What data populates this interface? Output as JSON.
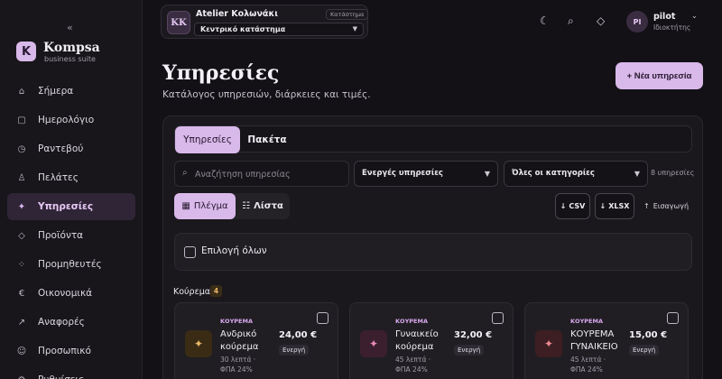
{
  "sidebar": {
    "collapse_icon": "«",
    "brand": {
      "logo_letter": "K",
      "name": "Kompsa",
      "subtitle": "business suite"
    },
    "items": [
      {
        "label": "Σήμερα",
        "icon": "home-icon",
        "glyph": "⌂",
        "active": false
      },
      {
        "label": "Ημερολόγιο",
        "icon": "calendar-icon",
        "glyph": "▢",
        "active": false
      },
      {
        "label": "Ραντεβού",
        "icon": "clock-icon",
        "glyph": "◷",
        "active": false
      },
      {
        "label": "Πελάτες",
        "icon": "user-icon",
        "glyph": "♙",
        "active": false
      },
      {
        "label": "Υπηρεσίες",
        "icon": "sparkle-icon",
        "glyph": "✦",
        "active": true
      },
      {
        "label": "Προϊόντα",
        "icon": "diamond-icon",
        "glyph": "◇",
        "active": false
      },
      {
        "label": "Προμηθευτές",
        "icon": "dots-icon",
        "glyph": "⁘",
        "active": false
      },
      {
        "label": "Οικονομικά",
        "icon": "euro-icon",
        "glyph": "€",
        "active": false
      },
      {
        "label": "Αναφορές",
        "icon": "trend-icon",
        "glyph": "↗",
        "active": false
      },
      {
        "label": "Προσωπικό",
        "icon": "staff-icon",
        "glyph": "☺",
        "active": false
      },
      {
        "label": "Ρυθμίσεις",
        "icon": "gear-icon",
        "glyph": "⚙",
        "active": false
      }
    ]
  },
  "topbar": {
    "store": {
      "initials": "KK",
      "name": "Atelier Κολωνάκι",
      "badge": "Κατάστημα",
      "branch": "Κεντρικό κατάστημα"
    },
    "icons": {
      "theme": "☾",
      "search": "⌕",
      "diamond": "◇"
    },
    "user": {
      "initials": "PI",
      "name": "pilot",
      "role": "Ιδιοκτήτης"
    }
  },
  "page": {
    "title": "Υπηρεσίες",
    "subtitle": "Κατάλογος υπηρεσιών, διάρκειες και τιμές.",
    "new_button": "+ Νέα υπηρεσία"
  },
  "tabs": [
    {
      "label": "Υπηρεσίες"
    },
    {
      "label": "Πακέτα"
    }
  ],
  "filters": {
    "search_placeholder": "Αναζήτηση υπηρεσίας",
    "status_select": "Ενεργές υπηρεσίες",
    "category_select": "Όλες οι κατηγορίες",
    "count": "8 υπηρεσίες"
  },
  "view": {
    "grid": "Πλέγμα",
    "list": "Λίστα",
    "grid_icon": "▦",
    "list_icon": "☷"
  },
  "export": {
    "csv": "CSV",
    "xlsx": "XLSX",
    "import": "Εισαγωγή",
    "down_arrow": "↓",
    "up_arrow": "↑"
  },
  "select_all": "Επιλογή όλων",
  "group": {
    "title": "Κούρεμα",
    "count": "4"
  },
  "cards": [
    {
      "category": "ΚΟΥΡΕΜΑ",
      "name": "Ανδρικό κούρεμα",
      "duration": "30 λεπτά ·",
      "vat": "ΦΠΑ 24%",
      "price": "24,00 €",
      "status": "Ενεργή",
      "icon_bg": "#3a2c14",
      "icon_color": "#e8b96a"
    },
    {
      "category": "ΚΟΥΡΕΜΑ",
      "name": "Γυναικείο κούρεμα",
      "duration": "45 λεπτά ·",
      "vat": "ΦΠΑ 24%",
      "price": "32,00 €",
      "status": "Ενεργή",
      "icon_bg": "#3b1f2e",
      "icon_color": "#e88ab8"
    },
    {
      "category": "ΚΟΥΡΕΜΑ",
      "name": "ΚΟΥΡΕΜΑ ΓΥΝΑΙΚΕΙΟ",
      "duration": "45 λεπτά ·",
      "vat": "ΦΠΑ 24%",
      "price": "15,00 €",
      "status": "Ενεργή",
      "icon_bg": "#3d1e22",
      "icon_color": "#ee8a94"
    }
  ]
}
